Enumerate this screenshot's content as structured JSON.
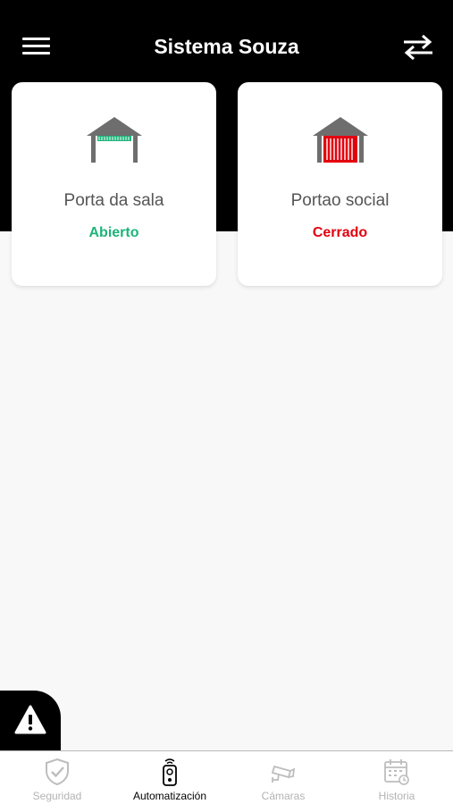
{
  "header": {
    "title": "Sistema Souza"
  },
  "devices": [
    {
      "name": "Porta da sala",
      "status": "Abierto",
      "status_color": "#1db47a",
      "state": "open"
    },
    {
      "name": "Portao social",
      "status": "Cerrado",
      "status_color": "#e3000f",
      "state": "closed"
    }
  ],
  "tabs": [
    {
      "label": "Seguridad",
      "icon": "shield-check-icon",
      "active": false
    },
    {
      "label": "Automatización",
      "icon": "remote-control-icon",
      "active": true
    },
    {
      "label": "Cámaras",
      "icon": "security-camera-icon",
      "active": false
    },
    {
      "label": "Historia",
      "icon": "calendar-history-icon",
      "active": false
    }
  ],
  "colors": {
    "header_bg": "#000000",
    "open_accent": "#1db47a",
    "closed_accent": "#e3000f",
    "garage_roof": "#6e6e6e",
    "inactive_tab": "#b3b3b3"
  }
}
